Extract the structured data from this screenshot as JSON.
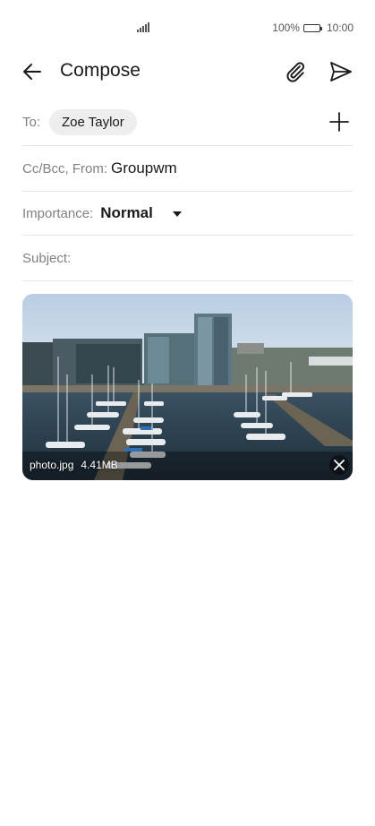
{
  "status_bar": {
    "battery": "100%",
    "time": "10:00",
    "icons": [
      "signal-icon",
      "battery-icon"
    ]
  },
  "app_bar": {
    "title": "Compose",
    "icons": [
      "back-arrow-icon",
      "paperclip-icon",
      "send-icon"
    ]
  },
  "fields": {
    "to_label": "To:",
    "to_recipient": "Zoe Taylor",
    "cc_label": "Cc/Bcc, From:",
    "cc_value": "Groupwm",
    "importance_label": "Importance:",
    "importance_value": "Normal",
    "subject_label": "Subject:",
    "subject_value": ""
  },
  "attachment": {
    "filename": "photo.jpg",
    "size": "4.41MB",
    "icon": "close-icon"
  },
  "colors": {
    "text": "#1a1a1a",
    "label": "#808080",
    "divider": "#e6e6e6",
    "chip": "#eeeeee"
  }
}
